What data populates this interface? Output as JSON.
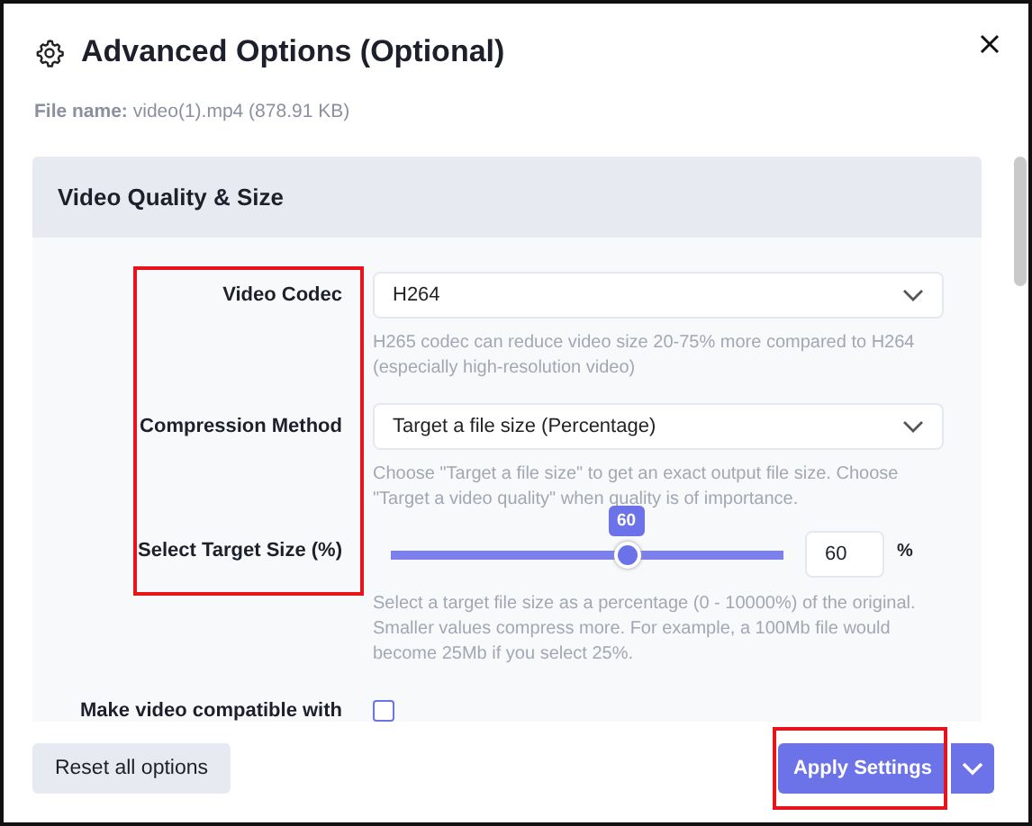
{
  "dialog": {
    "title": "Advanced Options (Optional)",
    "file_info": "**File name:** video(1).mp4 (878.91 KB)"
  },
  "section": {
    "title": "Video Quality & Size"
  },
  "rows": [
    {
      "kind": "select",
      "label": "Video Codec",
      "value": "H264",
      "help": "H265 codec can reduce video size 20-75% more compared to H264 (especially high-resolution video)"
    },
    {
      "kind": "select",
      "label": "Compression Method",
      "value": "Target a file size (Percentage)",
      "help": "Choose \"Target a file size\" to get an exact output file size. Choose \"Target a video quality\" when quality is of importance."
    },
    {
      "kind": "slider",
      "label": "Select Target Size (%)",
      "level": 0.6,
      "bubble": "60",
      "value": "60",
      "unit": "%",
      "help": "Select a target file size as a percentage (0 - 10000%) of the original. Smaller values compress more. For example, a 100Mb file would become 25Mb if you select 25%."
    },
    {
      "kind": "checkbox",
      "label": "Make video compatible with",
      "checked": false
    }
  ],
  "buttons": {
    "reset": "Reset all options",
    "apply": "Apply Settings"
  }
}
